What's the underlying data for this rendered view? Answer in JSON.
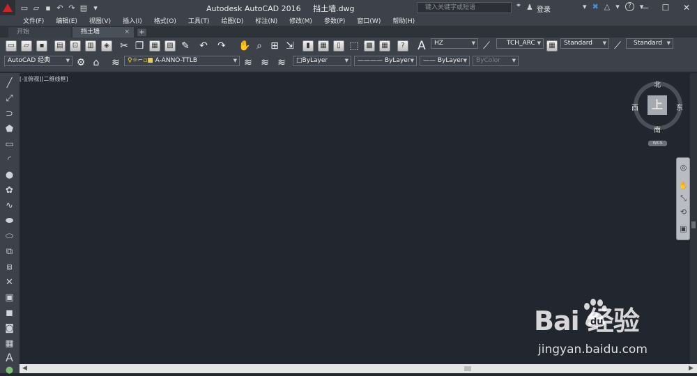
{
  "titlebar": {
    "app_title": "Autodesk AutoCAD 2016",
    "file_name": "挡土墙.dwg",
    "search_placeholder": "键入关键字或短语",
    "login": "登录",
    "help": "?"
  },
  "menu": [
    "文件(F)",
    "编辑(E)",
    "视图(V)",
    "插入(I)",
    "格式(O)",
    "工具(T)",
    "绘图(D)",
    "标注(N)",
    "修改(M)",
    "参数(P)",
    "窗口(W)",
    "帮助(H)"
  ],
  "tabs": {
    "start": "开始",
    "active": "挡土墙",
    "close": "×",
    "add": "+"
  },
  "toolbar1": {
    "text_style": "HZ",
    "dim_style": "TCH_ARC",
    "table_style": "Standard",
    "mleader_style": "Standard"
  },
  "toolbar2": {
    "workspace": "AutoCAD 经典",
    "layer": "A-ANNO-TTLB",
    "color": "ByLayer",
    "linetype": "ByLayer",
    "lineweight": "ByLayer",
    "plotstyle": "ByColor"
  },
  "viewport_label": "[-][俯视][二维线框]",
  "viewcube": {
    "face": "上",
    "north": "北",
    "south": "南",
    "east": "东",
    "west": "西",
    "wcs": "WCS"
  },
  "watermark": {
    "brand": "Bai  经验",
    "url": "jingyan.baidu.com"
  },
  "colors": {
    "title_bar": "#3c414a",
    "canvas": "#22262e",
    "accent_red": "#d02323"
  }
}
